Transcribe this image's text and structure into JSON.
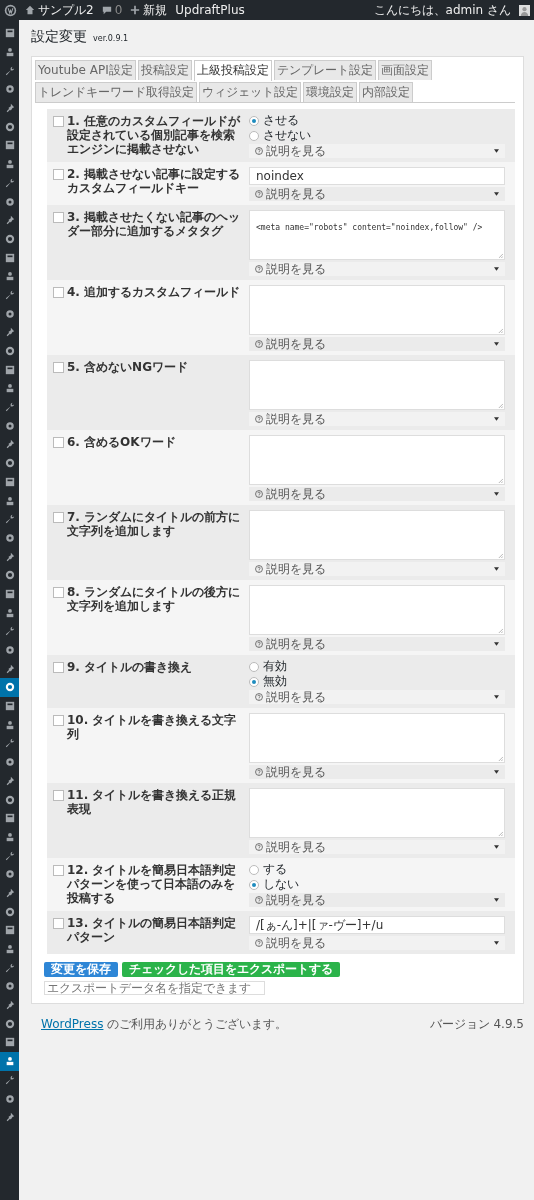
{
  "admin_bar": {
    "site": "サンプル2",
    "comments": "0",
    "new": "新規",
    "plugin": "UpdraftPlus",
    "greeting": "こんにちは、admin さん"
  },
  "sidebar": {
    "items": [
      {
        "selected": false
      },
      {
        "selected": false
      },
      {
        "selected": false
      },
      {
        "selected": false
      },
      {
        "selected": false
      },
      {
        "selected": false
      },
      {
        "selected": false
      },
      {
        "selected": false
      },
      {
        "selected": false
      },
      {
        "selected": false
      },
      {
        "selected": false
      },
      {
        "selected": false
      },
      {
        "selected": false
      },
      {
        "selected": false
      },
      {
        "selected": false
      },
      {
        "selected": false
      },
      {
        "selected": false
      },
      {
        "selected": false
      },
      {
        "selected": false
      },
      {
        "selected": false
      },
      {
        "selected": false
      },
      {
        "selected": false
      },
      {
        "selected": false
      },
      {
        "selected": false
      },
      {
        "selected": false
      },
      {
        "selected": false
      },
      {
        "selected": false
      },
      {
        "selected": false
      },
      {
        "selected": false
      },
      {
        "selected": false
      },
      {
        "selected": false
      },
      {
        "selected": false
      },
      {
        "selected": false
      },
      {
        "selected": false
      },
      {
        "selected": false
      },
      {
        "selected": true
      },
      {
        "selected": false
      },
      {
        "selected": false
      },
      {
        "selected": false
      },
      {
        "selected": false
      },
      {
        "selected": false
      },
      {
        "selected": false
      },
      {
        "selected": false
      },
      {
        "selected": false
      },
      {
        "selected": false
      },
      {
        "selected": false
      },
      {
        "selected": false
      },
      {
        "selected": false
      },
      {
        "selected": false
      },
      {
        "selected": false
      },
      {
        "selected": false
      },
      {
        "selected": false
      },
      {
        "selected": false
      },
      {
        "selected": false
      },
      {
        "selected": false
      },
      {
        "selected": true
      },
      {
        "selected": false
      },
      {
        "selected": false
      },
      {
        "selected": false
      }
    ]
  },
  "page": {
    "title": "設定変更",
    "version": "ver.0.9.1"
  },
  "tabs": [
    {
      "label": "Youtube API設定",
      "selected": false
    },
    {
      "label": "投稿設定",
      "selected": false
    },
    {
      "label": "上級投稿設定",
      "selected": true
    },
    {
      "label": "テンプレート設定",
      "selected": false
    },
    {
      "label": "画面設定",
      "selected": false
    },
    {
      "label": "トレンドキーワード取得設定",
      "selected": false
    },
    {
      "label": "ウィジェット設定",
      "selected": false
    },
    {
      "label": "環境設定",
      "selected": false
    },
    {
      "label": "内部設定",
      "selected": false
    }
  ],
  "settings": [
    {
      "label": "1. 任意のカスタムフィールドが設定されている個別記事を検索エンジンに掲載させない",
      "checked": false,
      "kind": "radio",
      "options": [
        {
          "label": "させる",
          "selected": true
        },
        {
          "label": "させない",
          "selected": false
        }
      ],
      "help": "説明を見る"
    },
    {
      "label": "2. 掲載させない記事に設定するカスタムフィールドキー",
      "checked": false,
      "kind": "text",
      "value": "noindex",
      "help": "説明を見る"
    },
    {
      "label": "3. 掲載させたくない記事のヘッダー部分に追加するメタタグ",
      "checked": false,
      "kind": "textarea",
      "value": "<meta name=\"robots\" content=\"noindex,follow\" />",
      "help": "説明を見る"
    },
    {
      "label": "4. 追加するカスタムフィールド",
      "checked": false,
      "kind": "textarea",
      "help": "説明を見る"
    },
    {
      "label": "5. 含めないNGワード",
      "checked": false,
      "kind": "textarea",
      "help": "説明を見る"
    },
    {
      "label": "6. 含めるOKワード",
      "checked": false,
      "kind": "textarea",
      "help": "説明を見る"
    },
    {
      "label": "7. ランダムにタイトルの前方に文字列を追加します",
      "checked": false,
      "kind": "textarea",
      "help": "説明を見る"
    },
    {
      "label": "8. ランダムにタイトルの後方に文字列を追加します",
      "checked": false,
      "kind": "textarea",
      "help": "説明を見る"
    },
    {
      "label": "9. タイトルの書き換え",
      "checked": false,
      "kind": "radio",
      "options": [
        {
          "label": "有効",
          "selected": false
        },
        {
          "label": "無効",
          "selected": true
        }
      ],
      "help": "説明を見る"
    },
    {
      "label": "10. タイトルを書き換える文字列",
      "checked": false,
      "kind": "textarea",
      "help": "説明を見る"
    },
    {
      "label": "11. タイトルを書き換える正規表現",
      "checked": false,
      "kind": "textarea",
      "help": "説明を見る"
    },
    {
      "label": "12. タイトルを簡易日本語判定パターンを使って日本語のみを投稿する",
      "checked": false,
      "kind": "radio",
      "options": [
        {
          "label": "する",
          "selected": false
        },
        {
          "label": "しない",
          "selected": true
        }
      ],
      "help": "説明を見る"
    },
    {
      "label": "13. タイトルの簡易日本語判定パターン",
      "checked": false,
      "kind": "text",
      "value": "/[ぁ-ん]+|[ァ-ヴー]+/u",
      "help": "説明を見る"
    }
  ],
  "actions": {
    "save": "変更を保存",
    "export": "チェックした項目をエクスポートする",
    "export_name_placeholder": "エクスポートデータ名を指定できます"
  },
  "footer": {
    "link": "WordPress",
    "thanks": "のご利用ありがとうございます。",
    "version": "バージョン 4.9.5"
  }
}
